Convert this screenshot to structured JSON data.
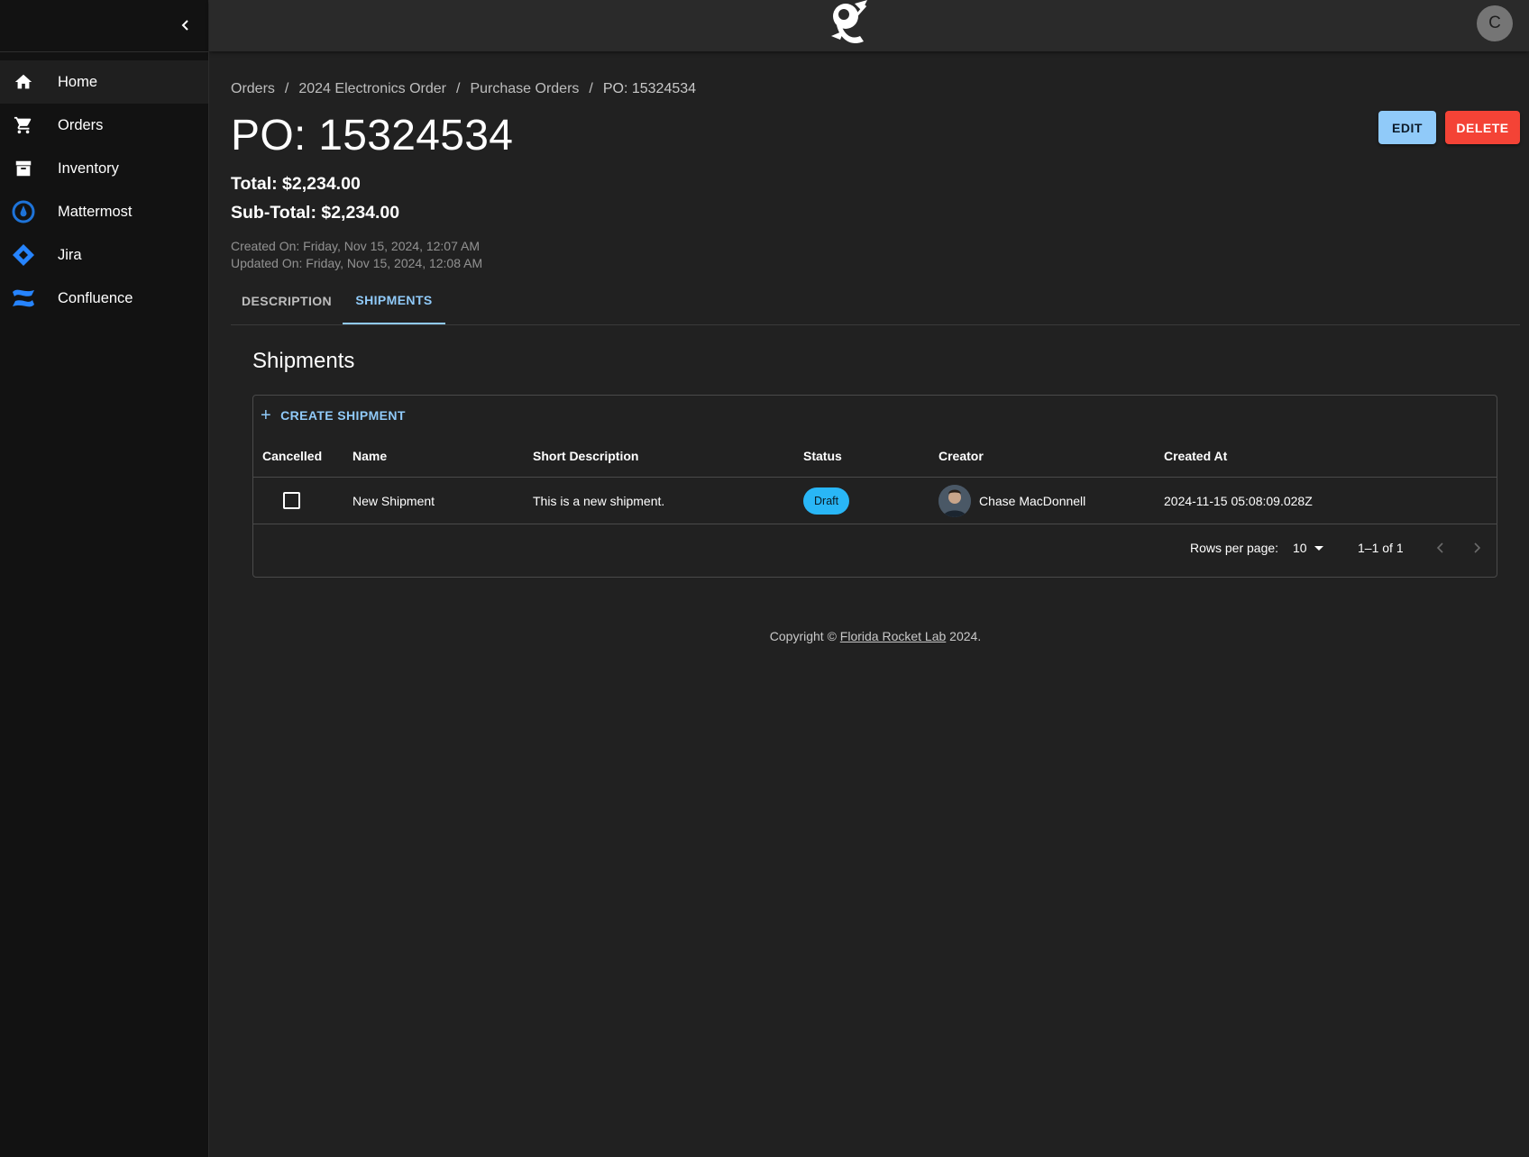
{
  "sidebar": {
    "items": [
      {
        "label": "Home",
        "icon": "home-icon"
      },
      {
        "label": "Orders",
        "icon": "cart-icon"
      },
      {
        "label": "Inventory",
        "icon": "archive-icon"
      },
      {
        "label": "Mattermost",
        "icon": "mattermost-icon"
      },
      {
        "label": "Jira",
        "icon": "jira-icon"
      },
      {
        "label": "Confluence",
        "icon": "confluence-icon"
      }
    ]
  },
  "topbar": {
    "avatar_initial": "C"
  },
  "breadcrumb": [
    "Orders",
    "2024 Electronics Order",
    "Purchase Orders",
    "PO: 15324534"
  ],
  "page": {
    "title": "PO: 15324534",
    "edit_label": "EDIT",
    "delete_label": "DELETE",
    "total": "Total: $2,234.00",
    "subtotal": "Sub-Total: $2,234.00",
    "created_on": "Created On: Friday, Nov 15, 2024, 12:07 AM",
    "updated_on": "Updated On: Friday, Nov 15, 2024, 12:08 AM"
  },
  "tabs": [
    "DESCRIPTION",
    "SHIPMENTS"
  ],
  "shipments": {
    "title": "Shipments",
    "create_label": "CREATE SHIPMENT",
    "columns": [
      "Cancelled",
      "Name",
      "Short Description",
      "Status",
      "Creator",
      "Created At"
    ],
    "rows": [
      {
        "cancelled": false,
        "name": "New Shipment",
        "short_description": "This is a new shipment.",
        "status": "Draft",
        "creator": "Chase MacDonnell",
        "created_at": "2024-11-15 05:08:09.028Z"
      }
    ],
    "rows_per_page_label": "Rows per page:",
    "rows_per_page": "10",
    "page_info": "1–1 of 1"
  },
  "footer": {
    "prefix": "Copyright © ",
    "link": "Florida Rocket Lab",
    "suffix": " 2024."
  },
  "colors": {
    "accent": "#90caf9",
    "danger": "#f44336",
    "status_draft": "#29b6f6",
    "background": "#212121",
    "sidebar": "#121212"
  }
}
